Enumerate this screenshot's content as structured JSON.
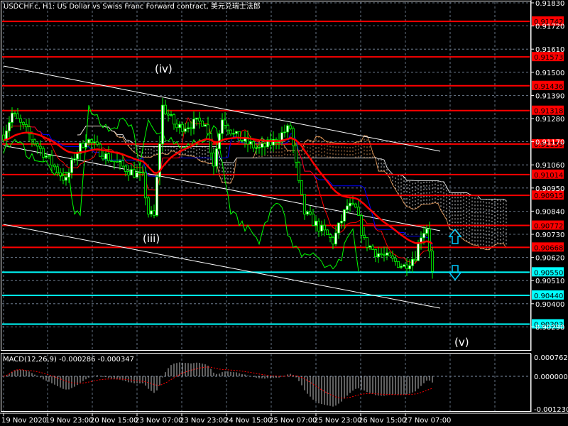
{
  "window": {
    "title": "USDCHF.c, H1:  US Dollar vs Swiss Franc Forward contract, 美元兑瑞士法郎"
  },
  "colors": {
    "background": "#000000",
    "grid": "#7f8fa6",
    "candle": "#00ff00",
    "resistance": "#ff0000",
    "support": "#00ffff",
    "channel": "#ffffff",
    "kijun": "#0000ff",
    "tenkan": "#ff0000",
    "chikou": "#00ff00",
    "cloud_up": "#f4a460",
    "cloud_down": "#ffffff",
    "macd_hist": "#c0c0c0",
    "macd_signal": "#ff0000"
  },
  "price_axis": {
    "ticks": [
      "0.91830",
      "0.91720",
      "0.91610",
      "0.91500",
      "0.91390",
      "0.91280",
      "0.91170",
      "0.91060",
      "0.90950",
      "0.90840",
      "0.90730",
      "0.90620",
      "0.90510",
      "0.90400",
      "0.90290"
    ]
  },
  "levels": {
    "resistance": [
      "0.91742",
      "0.91573",
      "0.91436",
      "0.91318",
      "0.91159",
      "0.91014",
      "0.90915",
      "0.90772",
      "0.90668"
    ],
    "support": [
      "0.90550",
      "0.90440",
      "0.90303"
    ]
  },
  "wave_labels": {
    "iii": "(iii)",
    "iv": "(iv)",
    "v": "(v)"
  },
  "arrows": {
    "up": "arrow-up-icon",
    "down": "arrow-down-icon"
  },
  "time_axis": {
    "labels": [
      "19 Nov 2020",
      "19 Nov 23:00",
      "20 Nov 15:00",
      "23 Nov 07:00",
      "23 Nov 23:00",
      "24 Nov 15:00",
      "25 Nov 07:00",
      "25 Nov 23:00",
      "26 Nov 15:00",
      "27 Nov 07:00"
    ]
  },
  "macd": {
    "label": "MACD(12,26,9) -0.000286 -0.000347",
    "axis": [
      "0.000762",
      "0.000000",
      "-0.001230"
    ]
  },
  "chart_data": {
    "type": "candlestick",
    "symbol": "USDCHF.c",
    "timeframe": "H1",
    "ylim": [
      0.9025,
      0.9184
    ],
    "close_path": [
      {
        "bar": 0,
        "close": 0.91202
      },
      {
        "bar": 3,
        "close": 0.91304
      },
      {
        "bar": 6,
        "close": 0.91253
      },
      {
        "bar": 11,
        "close": 0.91169
      },
      {
        "bar": 16,
        "close": 0.91084
      },
      {
        "bar": 22,
        "close": 0.90983
      },
      {
        "bar": 25,
        "close": 0.91101
      },
      {
        "bar": 29,
        "close": 0.91186
      },
      {
        "bar": 36,
        "close": 0.91101
      },
      {
        "bar": 44,
        "close": 0.91034
      },
      {
        "bar": 49,
        "close": 0.91
      },
      {
        "bar": 51,
        "close": 0.90831
      },
      {
        "bar": 53,
        "close": 0.90814
      },
      {
        "bar": 55,
        "close": 0.91169
      },
      {
        "bar": 56,
        "close": 0.91337
      },
      {
        "bar": 61,
        "close": 0.91236
      },
      {
        "bar": 66,
        "close": 0.91253
      },
      {
        "bar": 71,
        "close": 0.9127
      },
      {
        "bar": 74,
        "close": 0.91067
      },
      {
        "bar": 77,
        "close": 0.91287
      },
      {
        "bar": 81,
        "close": 0.91202
      },
      {
        "bar": 85,
        "close": 0.91169
      },
      {
        "bar": 90,
        "close": 0.91135
      },
      {
        "bar": 95,
        "close": 0.91169
      },
      {
        "bar": 99,
        "close": 0.91219
      },
      {
        "bar": 101,
        "close": 0.91236
      },
      {
        "bar": 104,
        "close": 0.90966
      },
      {
        "bar": 106,
        "close": 0.90831
      },
      {
        "bar": 111,
        "close": 0.90764
      },
      {
        "bar": 116,
        "close": 0.90696
      },
      {
        "bar": 121,
        "close": 0.90865
      },
      {
        "bar": 124,
        "close": 0.90848
      },
      {
        "bar": 127,
        "close": 0.90696
      },
      {
        "bar": 131,
        "close": 0.90646
      },
      {
        "bar": 136,
        "close": 0.90612
      },
      {
        "bar": 141,
        "close": 0.90578
      },
      {
        "bar": 145,
        "close": 0.90629
      },
      {
        "bar": 147,
        "close": 0.9073
      },
      {
        "bar": 149,
        "close": 0.90764
      },
      {
        "bar": 150,
        "close": 0.90663
      },
      {
        "bar": 151,
        "close": 0.90545
      }
    ],
    "indicators": [
      "Ichimoku",
      "Moving Average",
      "MACD(12,26,9)"
    ],
    "grid": true
  }
}
